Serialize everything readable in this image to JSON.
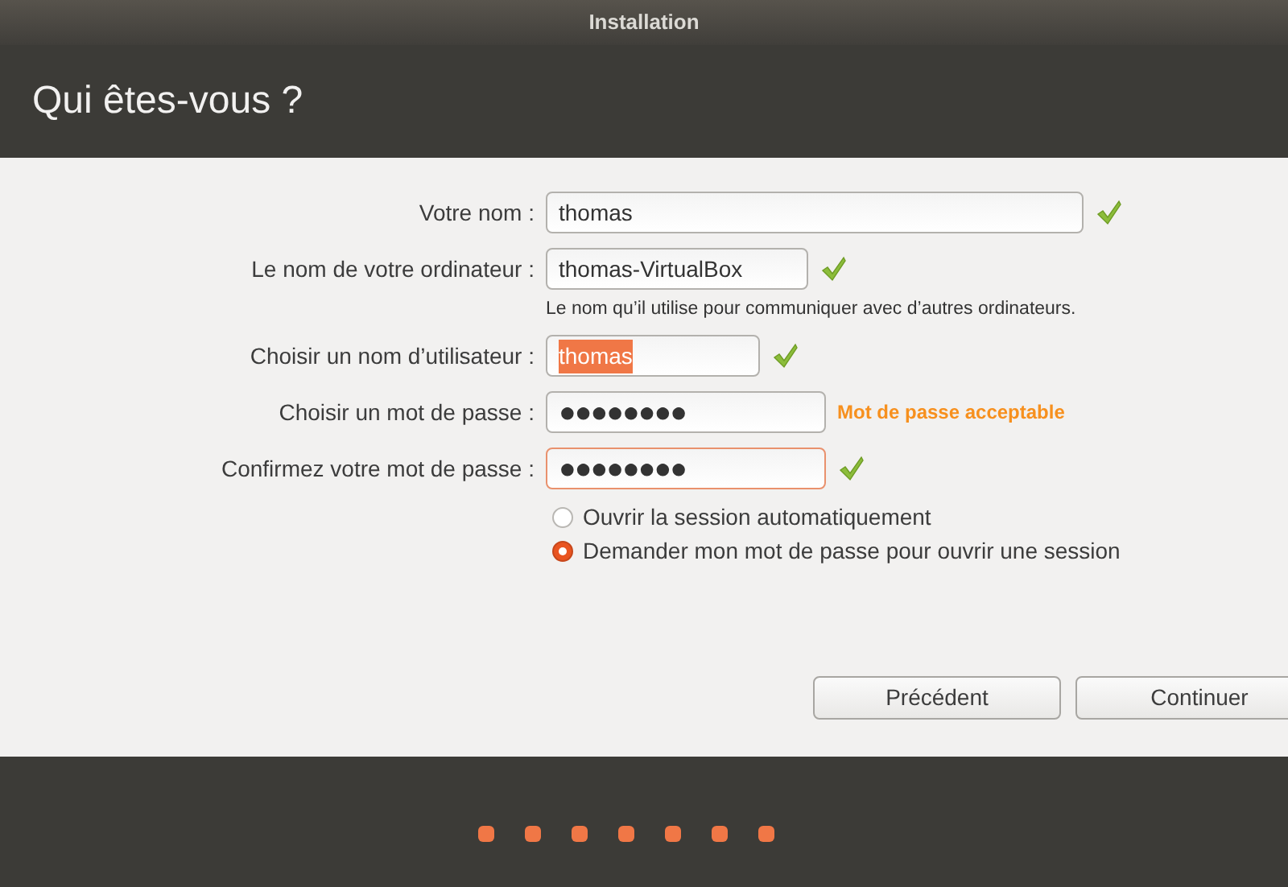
{
  "window": {
    "title": "Installation"
  },
  "heading": "Qui êtes-vous ?",
  "fields": [
    {
      "label": "Votre nom :",
      "value": "thomas",
      "kind": "text",
      "valid": true,
      "focused": false,
      "text_selected": false
    },
    {
      "label": "Le nom de votre ordinateur :",
      "value": "thomas-VirtualBox",
      "kind": "text",
      "valid": true,
      "focused": false,
      "text_selected": false,
      "hint": "Le nom qu’il utilise pour communiquer avec d’autres ordinateurs."
    },
    {
      "label": "Choisir un nom d’utilisateur :",
      "value": "thomas",
      "kind": "text",
      "valid": true,
      "focused": false,
      "text_selected": true
    },
    {
      "label": "Choisir un mot de passe :",
      "value": "●●●●●●●●",
      "kind": "password",
      "valid": false,
      "focused": false,
      "text_selected": false,
      "strength": "Mot de passe acceptable"
    },
    {
      "label": "Confirmez votre mot de passe :",
      "value": "●●●●●●●●",
      "kind": "password",
      "valid": true,
      "focused": true,
      "text_selected": false
    }
  ],
  "login_options": [
    {
      "label": "Ouvrir la session automatiquement",
      "selected": false
    },
    {
      "label": "Demander mon mot de passe pour ouvrir une session",
      "selected": true
    }
  ],
  "buttons": [
    "Précédent",
    "Continuer"
  ],
  "progress_steps": [
    {
      "completed": true
    },
    {
      "completed": true
    },
    {
      "completed": true
    },
    {
      "completed": true
    },
    {
      "completed": true
    },
    {
      "completed": true
    },
    {
      "completed": true
    }
  ]
}
